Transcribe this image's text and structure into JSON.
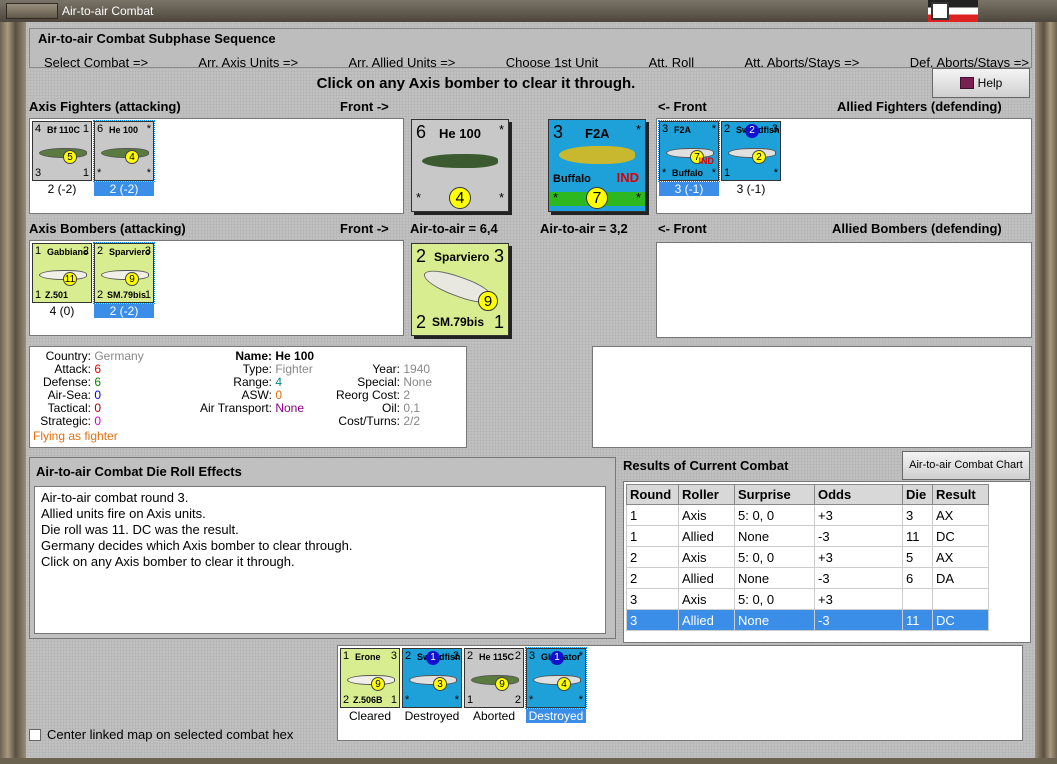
{
  "window": {
    "title": "Air-to-air Combat"
  },
  "subphase": {
    "heading": "Air-to-air Combat Subphase Sequence",
    "steps": [
      "Select Combat =>",
      "Arr. Axis Units =>",
      "Arr. Allied Units =>",
      "Choose 1st Unit",
      "Att. Roll",
      "Att. Aborts/Stays =>",
      "Def. Aborts/Stays =>"
    ]
  },
  "prompt": "Click on any Axis bomber to clear it through.",
  "help_label": "Help",
  "labels": {
    "axis_fighters": "Axis Fighters (attacking)",
    "front_right": "Front ->",
    "front_left": "<- Front",
    "allied_fighters": "Allied Fighters (defending)",
    "axis_bombers": "Axis Bombers (attacking)",
    "allied_bombers": "Allied Bombers (defending)",
    "axis_a2a": "Air-to-air = 6,4",
    "allied_a2a": "Air-to-air = 3,2"
  },
  "axis_fighters": [
    {
      "tl": "4",
      "name": "Bf 110C",
      "tr": "1",
      "bl": "3",
      "br": "1",
      "mid": "5",
      "caption": "2 (-2)",
      "selected": false,
      "color": "#c8c8c8"
    },
    {
      "tl": "6",
      "name": "He 100",
      "tr": "*",
      "bl": "*",
      "br": "*",
      "mid": "4",
      "caption": "2 (-2)",
      "selected": true,
      "color": "#c8c8c8"
    }
  ],
  "allied_fighters": [
    {
      "tl": "3",
      "name": "F2A",
      "tr": "*",
      "bl": "*",
      "br": "*",
      "mid": "7",
      "sub": "Buffalo",
      "tag": "IND",
      "caption": "3 (-1)",
      "selected": true,
      "color": "#1ea0d8"
    },
    {
      "tl": "2",
      "name": "Swordfish",
      "tr": "3",
      "bl": "1",
      "br": "*",
      "mid": "2",
      "badge": "2",
      "caption": "3 (-1)",
      "selected": false,
      "color": "#1ea0d8"
    }
  ],
  "axis_bombers": [
    {
      "tl": "1",
      "name": "Gabbiano",
      "tr": "2",
      "bl": "1",
      "br": "",
      "mid": "11",
      "sub": "Z.501",
      "caption": "4 (0)",
      "selected": false,
      "color": "#d8ec90"
    },
    {
      "tl": "2",
      "name": "Sparviero",
      "tr": "3",
      "bl": "2",
      "br": "1",
      "mid": "9",
      "sub": "SM.79bis",
      "caption": "2 (-2)",
      "selected": true,
      "color": "#d8ec90"
    }
  ],
  "big_axis_fighter": {
    "tl": "6",
    "name": "He 100",
    "tr": "*",
    "bl": "*",
    "br": "*",
    "mid": "4"
  },
  "big_allied_fighter": {
    "tl": "3",
    "name": "F2A",
    "tr": "*",
    "sub": "Buffalo",
    "tag": "IND",
    "bl": "*",
    "br": "*",
    "mid": "7"
  },
  "big_axis_bomber": {
    "tl": "2",
    "name": "Sparviero",
    "tr": "3",
    "bl": "2",
    "sub": "SM.79bis",
    "br": "1",
    "mid": "9"
  },
  "info": {
    "country_k": "Country:",
    "country": "Germany",
    "attack_k": "Attack:",
    "attack": "6",
    "defense_k": "Defense:",
    "defense": "6",
    "airsea_k": "Air-Sea:",
    "airsea": "0",
    "tactical_k": "Tactical:",
    "tactical": "0",
    "strategic_k": "Strategic:",
    "strategic": "0",
    "flying": "Flying as fighter",
    "name_k": "Name:",
    "name": "He 100",
    "type_k": "Type:",
    "type": "Fighter",
    "range_k": "Range:",
    "range": "4",
    "asw_k": "ASW:",
    "asw": "0",
    "airtrans_k": "Air Transport:",
    "airtrans": "None",
    "year_k": "Year:",
    "year": "1940",
    "special_k": "Special:",
    "special": "None",
    "reorg_k": "Reorg Cost:",
    "reorg": "2",
    "oil_k": "Oil:",
    "oil": "0,1",
    "cost_k": "Cost/Turns:",
    "cost": "2/2"
  },
  "die_roll": {
    "heading": "Air-to-air Combat Die Roll Effects",
    "lines": [
      "Air-to-air combat round 3.",
      "Allied units fire on Axis units.",
      "Die roll was 11.  DC was the result.",
      "Germany decides which Axis bomber to clear through.",
      "Click on any Axis bomber to clear it through."
    ]
  },
  "results": {
    "heading": "Results of Current Combat",
    "chart_button": "Air-to-air Combat Chart",
    "columns": [
      "Round",
      "Roller",
      "Surprise",
      "Odds",
      "Die",
      "Result"
    ],
    "rows": [
      [
        "1",
        "Axis",
        "5: 0, 0",
        "+3",
        "3",
        "AX"
      ],
      [
        "1",
        "Allied",
        "None",
        "-3",
        "11",
        "DC"
      ],
      [
        "2",
        "Axis",
        "5: 0, 0",
        "+3",
        "5",
        "AX"
      ],
      [
        "2",
        "Allied",
        "None",
        "-3",
        "6",
        "DA"
      ],
      [
        "3",
        "Axis",
        "5: 0, 0",
        "+3",
        "",
        ""
      ],
      [
        "3",
        "Allied",
        "None",
        "-3",
        "11",
        "DC"
      ]
    ],
    "selected_row": 5
  },
  "removed": [
    {
      "tl": "1",
      "name": "Erone",
      "tr": "3",
      "bl": "2",
      "br": "1",
      "mid": "9",
      "sub": "Z.506B",
      "caption": "Cleared",
      "selected": false,
      "color": "#d8ec90"
    },
    {
      "tl": "2",
      "name": "Swordfish",
      "tr": "2",
      "bl": "*",
      "br": "*",
      "mid": "3",
      "badge": "1",
      "caption": "Destroyed",
      "selected": false,
      "color": "#1ea0d8"
    },
    {
      "tl": "2",
      "name": "He 115C",
      "tr": "2",
      "bl": "1",
      "br": "2",
      "mid": "9",
      "caption": "Aborted",
      "selected": false,
      "color": "#c8c8c8"
    },
    {
      "tl": "3",
      "name": "Gladiator",
      "tr": "*",
      "bl": "*",
      "br": "*",
      "mid": "4",
      "badge": "1",
      "caption": "Destroyed",
      "selected": true,
      "color": "#1ea0d8"
    }
  ],
  "center_map_label": "Center linked map on selected combat hex"
}
